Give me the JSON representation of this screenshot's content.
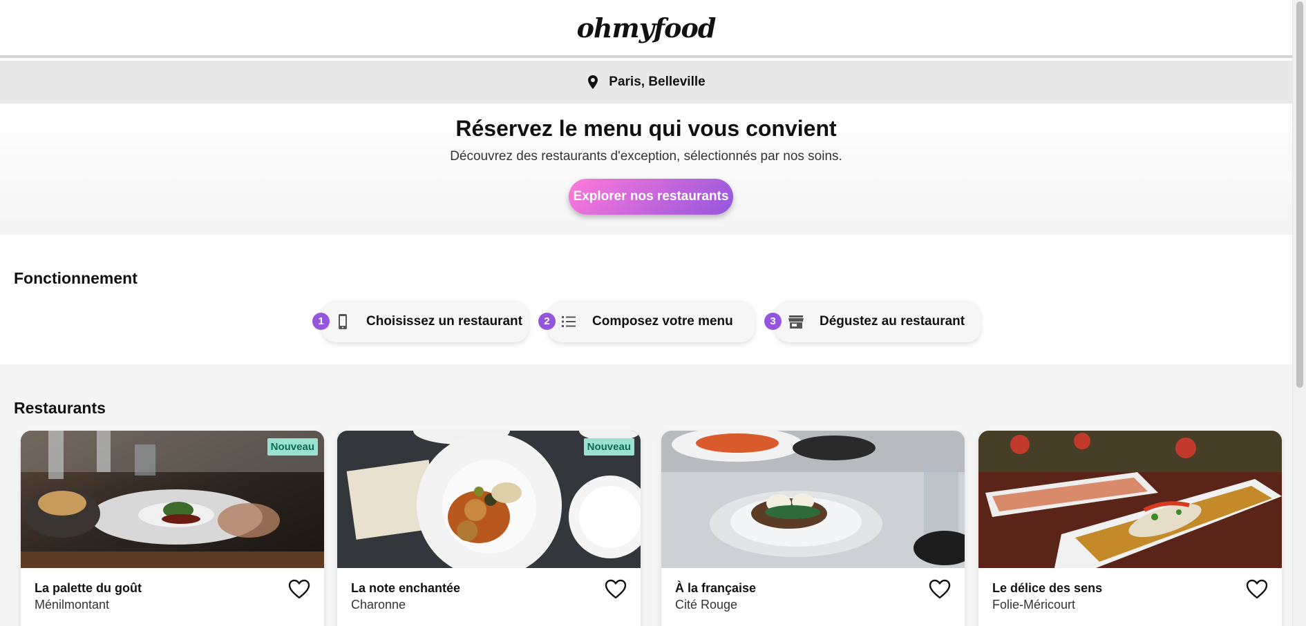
{
  "header": {
    "logo": "ohmyfood"
  },
  "location": {
    "icon": "location-pin-icon",
    "text": "Paris, Belleville"
  },
  "hero": {
    "title": "Réservez le menu qui vous convient",
    "subtitle": "Découvrez des restaurants d'exception, sélectionnés par nos soins.",
    "button_label": "Explorer nos restaurants"
  },
  "how": {
    "title": "Fonctionnement",
    "steps": [
      {
        "number": "1",
        "icon": "mobile-phone-icon",
        "label": "Choisissez un restaurant"
      },
      {
        "number": "2",
        "icon": "list-icon",
        "label": "Composez votre menu"
      },
      {
        "number": "3",
        "icon": "store-icon",
        "label": "Dégustez au restaurant"
      }
    ]
  },
  "restaurants": {
    "title": "Restaurants",
    "items": [
      {
        "name": "La palette du goût",
        "area": "Ménilmontant",
        "badge": "Nouveau"
      },
      {
        "name": "La note enchantée",
        "area": "Charonne",
        "badge": "Nouveau"
      },
      {
        "name": "À la française",
        "area": "Cité Rouge",
        "badge": ""
      },
      {
        "name": "Le délice des sens",
        "area": "Folie-Méricourt",
        "badge": ""
      }
    ]
  },
  "colors": {
    "accent_purple": "#9356dc",
    "accent_pink": "#ff79da",
    "badge_bg": "#99e2d0",
    "badge_text": "#0f6b53"
  }
}
